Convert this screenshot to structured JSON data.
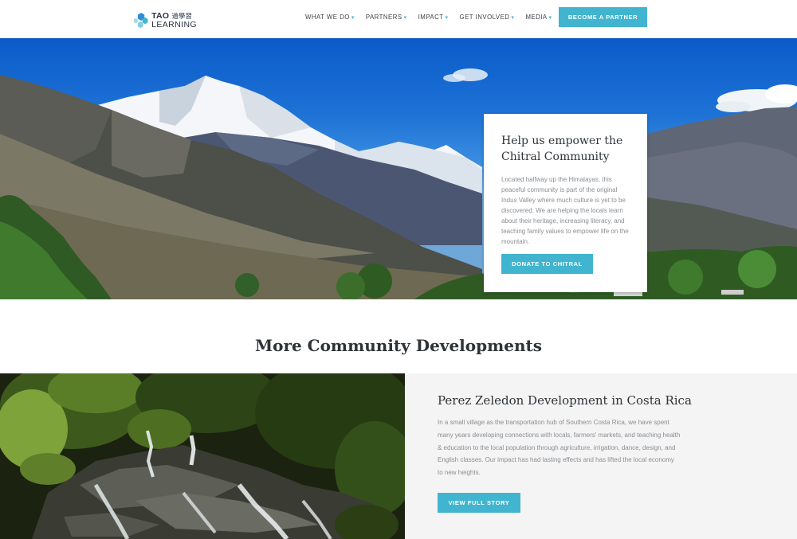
{
  "header": {
    "logo": {
      "name": "TAO",
      "cjk": "道學習",
      "sub": "LEARNING"
    },
    "nav": [
      {
        "label": "WHAT WE DO",
        "caret": "▾"
      },
      {
        "label": "PARTNERS",
        "caret": "▾"
      },
      {
        "label": "IMPACT",
        "caret": "▾"
      },
      {
        "label": "GET INVOLVED",
        "caret": "▾"
      },
      {
        "label": "MEDIA",
        "caret": "▾"
      }
    ],
    "cta_label": "BECOME A PARTNER"
  },
  "hero": {
    "title": "Help us empower the Chitral Community",
    "body": "Located halfway up the Himalayas, this peaceful community is part of the original Indus Valley where much culture is yet to be discovered. We are helping the locals learn about their heritage, increasing literacy, and teaching family values to empower life on the mountain.",
    "button_label": "DONATE TO CHITRAL"
  },
  "section": {
    "title": "More Community Developments"
  },
  "story": {
    "title": "Perez Zeledon Development in Costa Rica",
    "body": "In a small village as the transportation hub of Southern Costa Rica, we have spent many years developing connections with locals, farmers' markets, and teaching health & education to the local population through agriculture, irrigation, dance, design, and English classes. Our impact has had lasting effects and has lifted the local economy to new heights.",
    "button_label": "VIEW FULL STORY"
  },
  "colors": {
    "accent": "#41b5cf",
    "heading": "#2e3338",
    "body_text": "#8a8e93",
    "story_bg": "#f4f4f4"
  }
}
